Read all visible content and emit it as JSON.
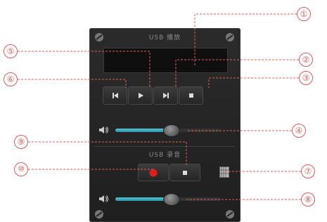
{
  "playback": {
    "title": "USB 播放"
  },
  "recording": {
    "title": "USB 录音"
  },
  "callouts": [
    "①",
    "②",
    "③",
    "④",
    "⑤",
    "⑥",
    "⑦",
    "⑧",
    "⑨",
    "⑩"
  ],
  "colors": {
    "panel": "#262626",
    "accent": "#2c8fa3",
    "record": "#e01e1e",
    "leader": "#e05c5c"
  },
  "volume": {
    "playback_level": 0.55,
    "record_level": 0.55
  },
  "icons": [
    "previous-icon",
    "play-icon",
    "next-icon",
    "stop-icon",
    "volume-icon",
    "record-icon",
    "storage-icon",
    "screw-icon"
  ]
}
